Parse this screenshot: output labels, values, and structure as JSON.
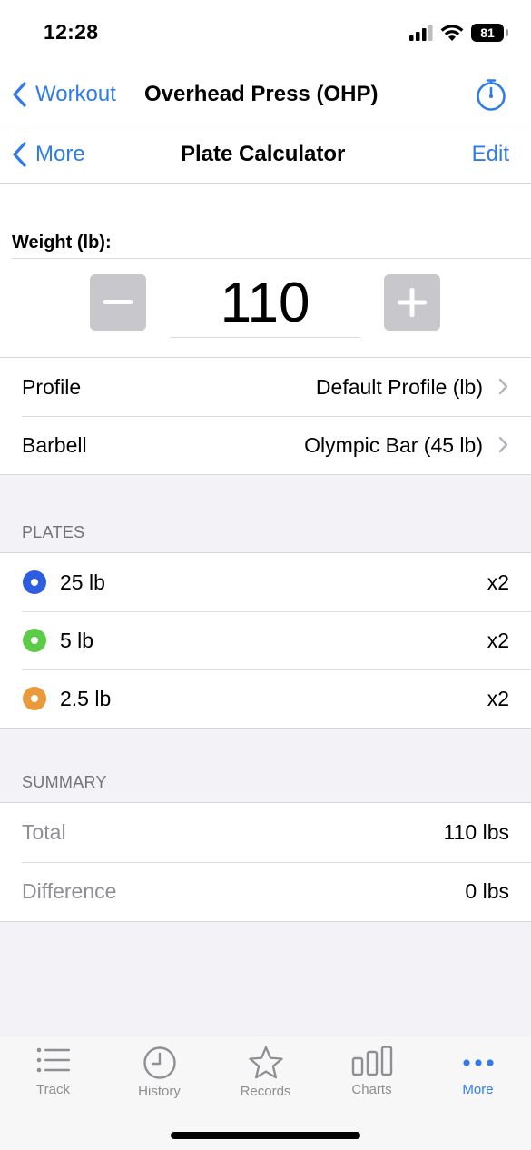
{
  "status": {
    "time": "12:28",
    "battery": "81"
  },
  "nav_workout": {
    "back_label": "Workout",
    "title": "Overhead Press (OHP)"
  },
  "nav_calc": {
    "back_label": "More",
    "title": "Plate Calculator",
    "edit_label": "Edit"
  },
  "weight": {
    "label": "Weight (lb):",
    "value": "110"
  },
  "settings": {
    "profile_label": "Profile",
    "profile_value": "Default Profile (lb)",
    "barbell_label": "Barbell",
    "barbell_value": "Olympic Bar (45 lb)"
  },
  "plates": {
    "header": "PLATES",
    "items": [
      {
        "label": "25 lb",
        "count": "x2",
        "color": "#2f5de0"
      },
      {
        "label": "5 lb",
        "count": "x2",
        "color": "#5ccb47"
      },
      {
        "label": "2.5 lb",
        "count": "x2",
        "color": "#ea9a3b"
      }
    ]
  },
  "summary": {
    "header": "SUMMARY",
    "total_label": "Total",
    "total_value": "110 lbs",
    "difference_label": "Difference",
    "difference_value": "0 lbs"
  },
  "tabbar": {
    "tabs": [
      {
        "label": "Track",
        "icon": "list-icon"
      },
      {
        "label": "History",
        "icon": "clock-icon"
      },
      {
        "label": "Records",
        "icon": "star-icon"
      },
      {
        "label": "Charts",
        "icon": "bar-chart-icon"
      },
      {
        "label": "More",
        "icon": "ellipsis-icon"
      }
    ],
    "active": "More"
  },
  "colors": {
    "accent": "#2f7bea"
  }
}
